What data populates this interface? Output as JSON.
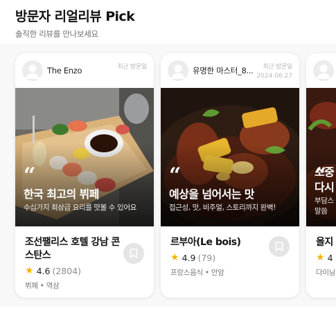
{
  "section": {
    "title": "방문자 리얼리뷰 Pick",
    "subtitle": "솔직한 리뷰를 만나보세요"
  },
  "cards": [
    {
      "reviewer": "The Enzo",
      "visit_label": "최근 방문일",
      "visit_date": "",
      "quote": "“",
      "headline": "한국 최고의 뷔페",
      "subline": "수십가지 최상급 요리를 맛볼 수 있어요",
      "name": "조선팰리스 호텔 강남 콘스탄스",
      "rating": "4.6",
      "count": "(2804)",
      "meta": "뷔페 • 역삼"
    },
    {
      "reviewer": "유명한 마스터_8...",
      "visit_label": "최근 방문일",
      "visit_date": "2024.06.27",
      "quote": "“",
      "headline": "예상을 넘어서는 맛",
      "subline": "접근성, 맛, 비주얼, 스토리까지 완벽!",
      "name": "르부아(Le bois)",
      "rating": "4.9",
      "count": "(79)",
      "meta": "프랑스음식 • 안암"
    },
    {
      "reviewer": "",
      "visit_label": "",
      "visit_date": "",
      "quote": "“",
      "headline": "소중",
      "headline2": "다시",
      "subline": "부담스",
      "subline2": "말씀",
      "name": "을지",
      "rating": "4",
      "count": "",
      "meta": "다이닝"
    }
  ],
  "icons": {
    "avatar": "person-icon",
    "star": "star-icon",
    "bookmark": "bookmark-icon"
  },
  "colors": {
    "star": "#f5b400",
    "strip_background": "#f8f8f8"
  }
}
